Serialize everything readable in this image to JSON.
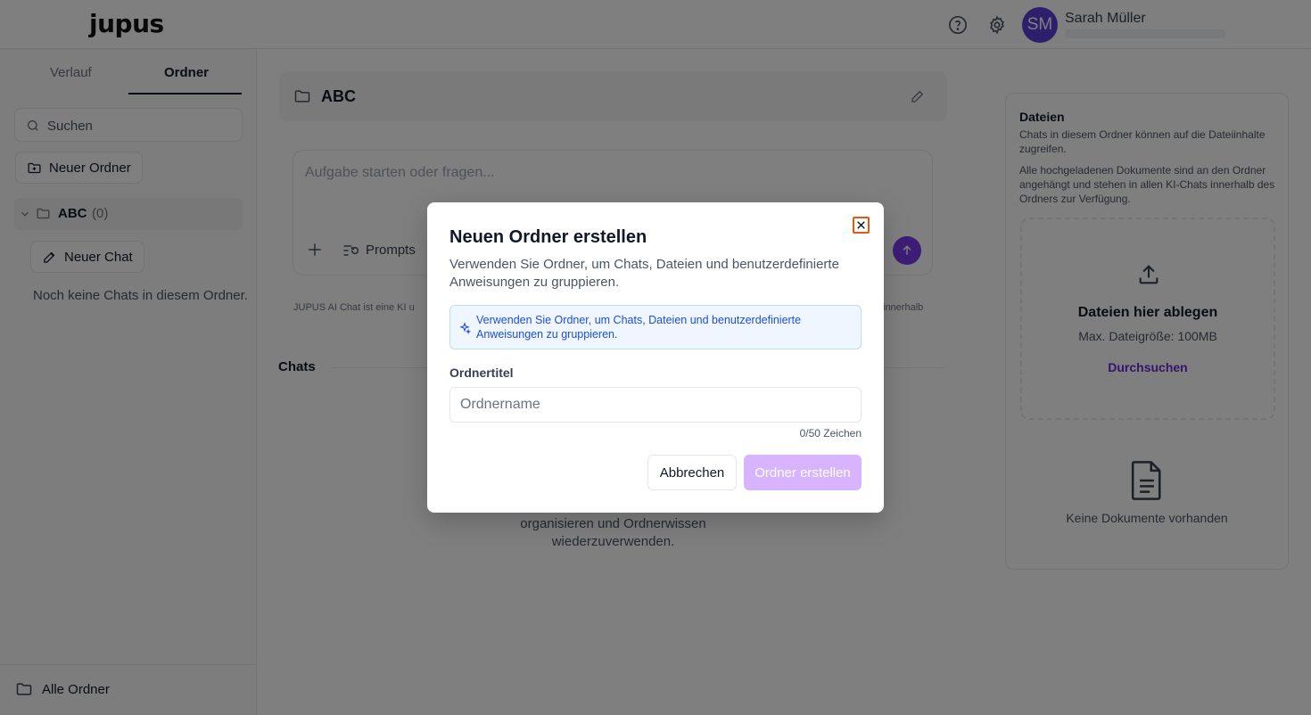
{
  "header": {
    "logo": "jupus",
    "user_name": "Sarah Müller",
    "avatar_initials": "SM",
    "avatar_color": "#5b3fd6"
  },
  "sidebar": {
    "tabs": [
      {
        "label": "Verlauf",
        "active": false
      },
      {
        "label": "Ordner",
        "active": true
      }
    ],
    "search_placeholder": "Suchen",
    "new_folder_label": "Neuer Ordner",
    "folder": {
      "name": "ABC",
      "count": "(0)"
    },
    "new_chat_label": "Neuer Chat",
    "no_chats_text": "Noch keine Chats in diesem Ordner.",
    "all_folders_label": "Alle Ordner"
  },
  "main": {
    "folder_title": "ABC",
    "composer_placeholder": "Aufgabe starten oder fragen...",
    "prompts_label": "Prompts",
    "disclaimer_start": "JUPUS AI Chat ist eine KI u",
    "disclaimer_end": "innerhalb",
    "chats_label": "Chats",
    "empty_text": "organisieren und Ordnerwissen wiederzuverwenden."
  },
  "files_panel": {
    "title": "Dateien",
    "desc1": "Chats in diesem Ordner können auf die Dateiinhalte zugreifen.",
    "desc2": "Alle hochgeladenen Dokumente sind an den Ordner angehängt und stehen in allen KI-Chats innerhalb des Ordners zur Verfügung.",
    "drop_title": "Dateien hier ablegen",
    "max_size": "Max. Dateigröße: 100MB",
    "browse_label": "Durchsuchen",
    "no_docs": "Keine Dokumente vorhanden"
  },
  "modal": {
    "title": "Neuen Ordner erstellen",
    "description": "Verwenden Sie Ordner, um Chats, Dateien und benutzerdefinierte Anweisungen zu gruppieren.",
    "info_text": "Verwenden Sie Ordner, um Chats, Dateien und benutzerdefinierte Anweisungen zu gruppieren.",
    "field_label": "Ordnertitel",
    "field_placeholder": "Ordnername",
    "field_value": "",
    "counter": "0/50 Zeichen",
    "cancel_label": "Abbrechen",
    "create_label": "Ordner erstellen",
    "accent_color": "#d8b4fe",
    "close_outline_color": "#ea580c"
  }
}
